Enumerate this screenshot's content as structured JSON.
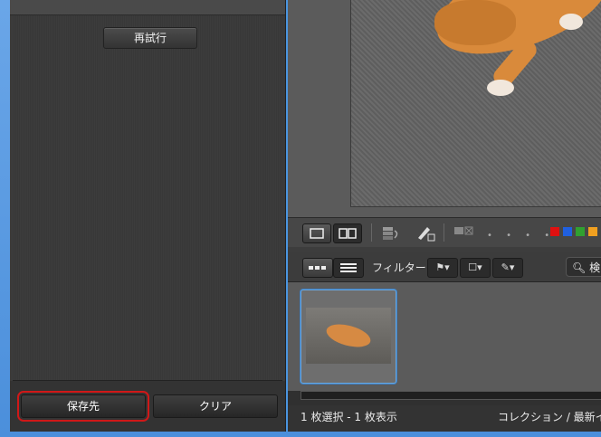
{
  "left_panel": {
    "retry_label": "再試行",
    "save_dest_label": "保存先",
    "clear_label": "クリア"
  },
  "filter_bar": {
    "filter_label": "フィルター:",
    "search_label": "検"
  },
  "status": {
    "selection_text": "1 枚選択 - 1 枚表示",
    "collection_text": "コレクション / 最新イ"
  },
  "label_colors": [
    "#e01010",
    "#2060e0",
    "#30a030",
    "#f0a020"
  ],
  "colors": {
    "highlight_red": "#d01818",
    "selection_blue": "#6aa8e0"
  }
}
